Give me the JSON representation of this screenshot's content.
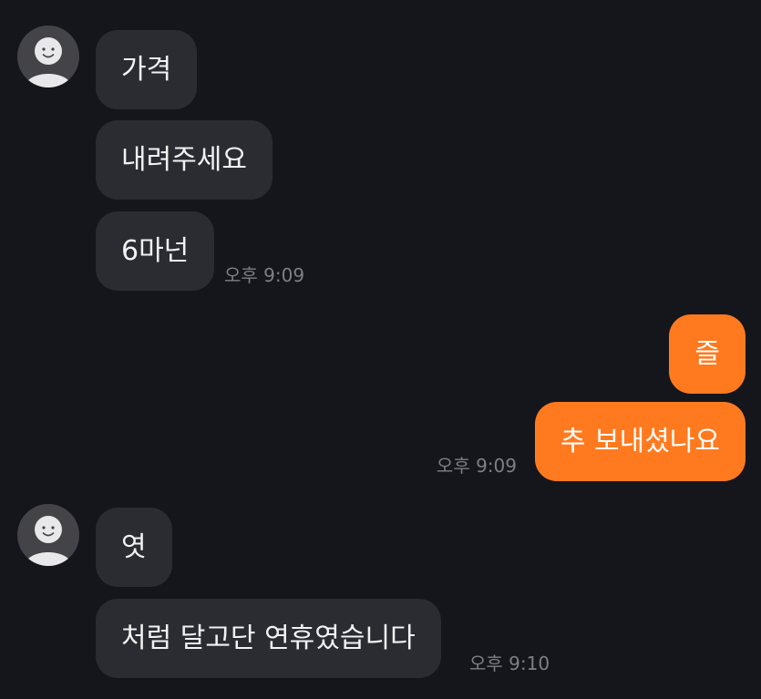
{
  "colors": {
    "background": "#15161b",
    "incoming_bubble": "#2b2c32",
    "outgoing_bubble": "#ff7a1f",
    "timestamp": "#7e7f85",
    "avatar": "#444448"
  },
  "icons": {
    "avatar": "default-profile-avatar-icon"
  },
  "groups": [
    {
      "sender": "other",
      "messages": [
        "가격",
        "내려주세요",
        "6마넌"
      ],
      "time": "오후 9:09"
    },
    {
      "sender": "me",
      "messages": [
        "즐",
        "추 보내셨나요"
      ],
      "time": "오후 9:09"
    },
    {
      "sender": "other",
      "messages": [
        "엿",
        "처럼 달고단 연휴였습니다"
      ],
      "time": "오후 9:10"
    }
  ]
}
